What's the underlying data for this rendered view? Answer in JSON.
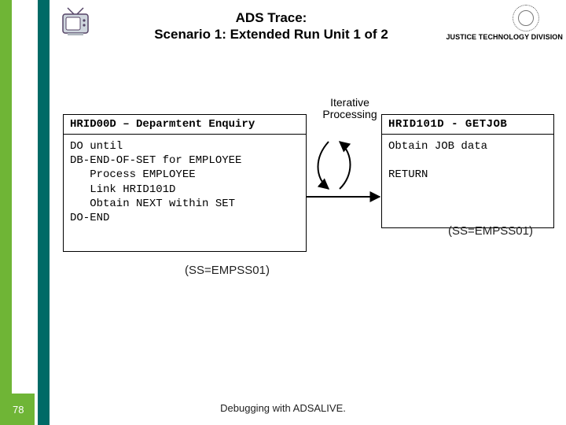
{
  "palette": {
    "green": "#6fb536",
    "teal": "#006a66"
  },
  "header": {
    "title_line1": "ADS Trace:",
    "title_line2": "Scenario 1: Extended Run Unit  1 of 2",
    "corp_label": "JUSTICE TECHNOLOGY DIVISION"
  },
  "diagram": {
    "iter_label": "Iterative Processing",
    "left_box": {
      "header": "HRID00D – Deparmtent Enquiry",
      "body": "DO until\nDB-END-OF-SET for EMPLOYEE\n   Process EMPLOYEE\n   Link HRID101D\n   Obtain NEXT within SET\nDO-END",
      "ss": "(SS=EMPSS01)"
    },
    "right_box": {
      "header": "HRID101D - GETJOB",
      "body": "Obtain JOB data\n\nRETURN",
      "ss": "(SS=EMPSS01)"
    }
  },
  "footer": {
    "page": "78",
    "text": "Debugging with ADSALIVE."
  }
}
